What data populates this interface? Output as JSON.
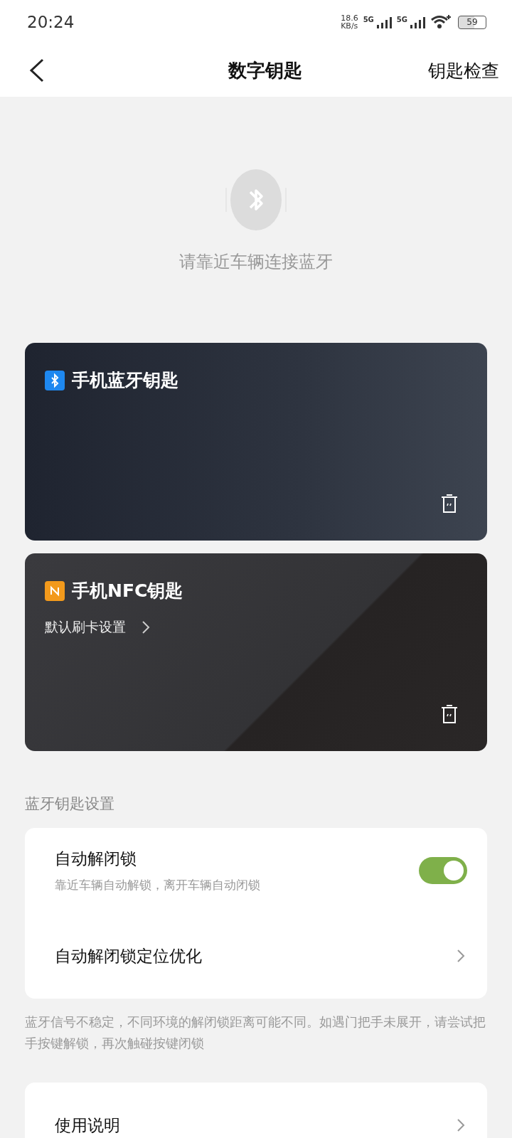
{
  "status_bar": {
    "time": "20:24",
    "speed_value": "18.6",
    "speed_unit": "KB/s",
    "networks": [
      "5G",
      "5G"
    ],
    "battery": "59"
  },
  "nav": {
    "title": "数字钥匙",
    "action": "钥匙检查"
  },
  "connect_hint": "请靠近车辆连接蓝牙",
  "keys": [
    {
      "kind": "bluetooth",
      "title": "手机蓝牙钥匙"
    },
    {
      "kind": "nfc",
      "title": "手机NFC钥匙",
      "link": "默认刷卡设置"
    }
  ],
  "section_title": "蓝牙钥匙设置",
  "settings": [
    {
      "kind": "toggle",
      "title": "自动解闭锁",
      "subtitle": "靠近车辆自动解锁，离开车辆自动闭锁",
      "on": true
    },
    {
      "kind": "link",
      "title": "自动解闭锁定位优化"
    }
  ],
  "note": "蓝牙信号不稳定，不同环境的解闭锁距离可能不同。如遇门把手未展开，请尝试把手按键解锁，再次触碰按键闭锁",
  "more": [
    {
      "kind": "link",
      "title": "使用说明"
    }
  ]
}
